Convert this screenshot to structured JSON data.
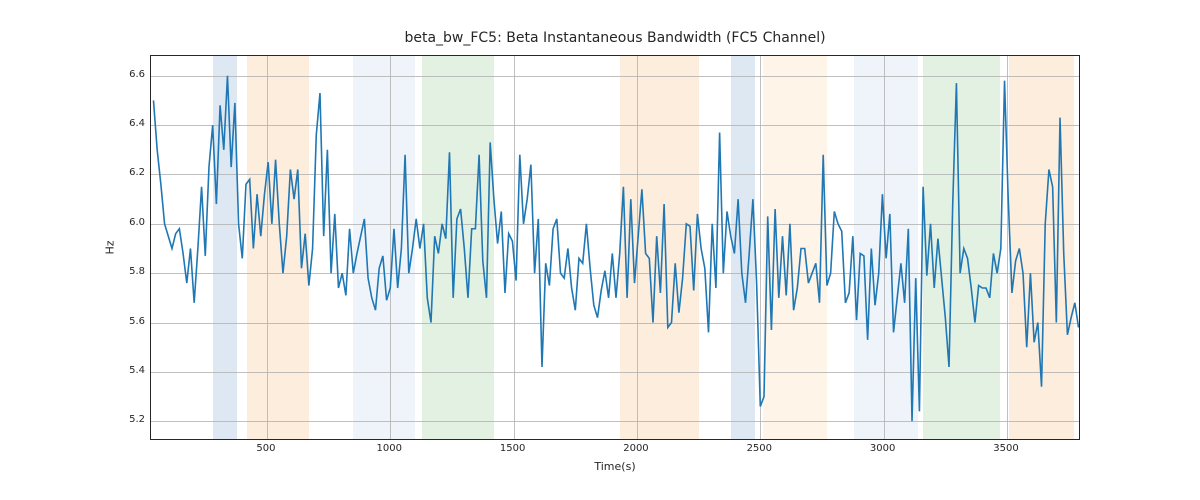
{
  "chart_data": {
    "type": "line",
    "title": "beta_bw_FC5: Beta Instantaneous Bandwidth (FC5 Channel)",
    "xlabel": "Time(s)",
    "ylabel": "Hz",
    "xlim": [
      30,
      3800
    ],
    "ylim": [
      5.12,
      6.68
    ],
    "xticks": [
      500,
      1000,
      1500,
      2000,
      2500,
      3000,
      3500
    ],
    "yticks": [
      5.2,
      5.4,
      5.6,
      5.8,
      6.0,
      6.2,
      6.4,
      6.6
    ],
    "bands": [
      {
        "x0": 280,
        "x1": 380,
        "color": "#b6cde2"
      },
      {
        "x0": 420,
        "x1": 670,
        "color": "#fad8b1"
      },
      {
        "x0": 850,
        "x1": 1100,
        "color": "#dbe7f3"
      },
      {
        "x0": 1130,
        "x1": 1420,
        "color": "#c1dfc0"
      },
      {
        "x0": 1930,
        "x1": 2250,
        "color": "#fad8b1"
      },
      {
        "x0": 2380,
        "x1": 2480,
        "color": "#b6cde2"
      },
      {
        "x0": 2510,
        "x1": 2770,
        "color": "#fce7cd"
      },
      {
        "x0": 2880,
        "x1": 3140,
        "color": "#dbe7f3"
      },
      {
        "x0": 3160,
        "x1": 3470,
        "color": "#c1dfc0"
      },
      {
        "x0": 3510,
        "x1": 3770,
        "color": "#fad8b1"
      }
    ],
    "series": [
      {
        "name": "beta_bw_FC5",
        "color": "#1f77b4",
        "x": [
          40,
          55,
          70,
          85,
          100,
          115,
          130,
          145,
          160,
          175,
          190,
          205,
          220,
          235,
          250,
          265,
          280,
          295,
          310,
          325,
          340,
          355,
          370,
          385,
          400,
          415,
          430,
          445,
          460,
          475,
          490,
          505,
          520,
          535,
          550,
          565,
          580,
          595,
          610,
          625,
          640,
          655,
          670,
          685,
          700,
          715,
          730,
          745,
          760,
          775,
          790,
          805,
          820,
          835,
          850,
          865,
          880,
          895,
          910,
          925,
          940,
          955,
          970,
          985,
          1000,
          1015,
          1030,
          1045,
          1060,
          1075,
          1090,
          1105,
          1120,
          1135,
          1150,
          1165,
          1180,
          1195,
          1210,
          1225,
          1240,
          1255,
          1270,
          1285,
          1300,
          1315,
          1330,
          1345,
          1360,
          1375,
          1390,
          1405,
          1420,
          1435,
          1450,
          1465,
          1480,
          1495,
          1510,
          1525,
          1540,
          1555,
          1570,
          1585,
          1600,
          1615,
          1630,
          1645,
          1660,
          1675,
          1690,
          1705,
          1720,
          1735,
          1750,
          1765,
          1780,
          1795,
          1810,
          1825,
          1840,
          1855,
          1870,
          1885,
          1900,
          1915,
          1930,
          1945,
          1960,
          1975,
          1990,
          2005,
          2020,
          2035,
          2050,
          2065,
          2080,
          2095,
          2110,
          2125,
          2140,
          2155,
          2170,
          2185,
          2200,
          2215,
          2230,
          2245,
          2260,
          2275,
          2290,
          2305,
          2320,
          2335,
          2350,
          2365,
          2380,
          2395,
          2410,
          2425,
          2440,
          2455,
          2470,
          2485,
          2500,
          2515,
          2530,
          2545,
          2560,
          2575,
          2590,
          2605,
          2620,
          2635,
          2650,
          2665,
          2680,
          2695,
          2710,
          2725,
          2740,
          2755,
          2770,
          2785,
          2800,
          2815,
          2830,
          2845,
          2860,
          2875,
          2890,
          2905,
          2920,
          2935,
          2950,
          2965,
          2980,
          2995,
          3010,
          3025,
          3040,
          3055,
          3070,
          3085,
          3100,
          3115,
          3130,
          3145,
          3160,
          3175,
          3190,
          3205,
          3220,
          3235,
          3250,
          3265,
          3280,
          3295,
          3310,
          3325,
          3340,
          3355,
          3370,
          3385,
          3400,
          3415,
          3430,
          3445,
          3460,
          3475,
          3490,
          3505,
          3520,
          3535,
          3550,
          3565,
          3580,
          3595,
          3610,
          3625,
          3640,
          3655,
          3670,
          3685,
          3700,
          3715,
          3730,
          3745,
          3760,
          3775,
          3790
        ],
        "y": [
          6.5,
          6.3,
          6.16,
          6.0,
          5.95,
          5.9,
          5.96,
          5.98,
          5.88,
          5.76,
          5.9,
          5.68,
          5.9,
          6.15,
          5.87,
          6.23,
          6.4,
          6.08,
          6.48,
          6.3,
          6.6,
          6.23,
          6.49,
          6.0,
          5.86,
          6.16,
          6.18,
          5.9,
          6.12,
          5.95,
          6.12,
          6.25,
          6.0,
          6.26,
          6.0,
          5.8,
          5.95,
          6.22,
          6.1,
          6.22,
          5.82,
          5.96,
          5.75,
          5.9,
          6.36,
          6.53,
          5.95,
          6.3,
          5.8,
          6.04,
          5.74,
          5.8,
          5.71,
          5.98,
          5.8,
          5.88,
          5.95,
          6.02,
          5.78,
          5.7,
          5.65,
          5.82,
          5.87,
          5.69,
          5.74,
          5.98,
          5.74,
          5.9,
          6.28,
          5.8,
          5.9,
          6.02,
          5.9,
          6.0,
          5.7,
          5.6,
          5.95,
          5.88,
          6.0,
          5.94,
          6.29,
          5.7,
          6.02,
          6.06,
          5.9,
          5.7,
          5.98,
          5.98,
          6.28,
          5.85,
          5.7,
          6.33,
          6.1,
          5.92,
          6.05,
          5.72,
          5.96,
          5.93,
          5.77,
          6.28,
          6.0,
          6.1,
          6.24,
          5.8,
          6.02,
          5.42,
          5.84,
          5.75,
          5.98,
          6.02,
          5.8,
          5.78,
          5.9,
          5.74,
          5.65,
          5.86,
          5.84,
          6.0,
          5.82,
          5.67,
          5.62,
          5.73,
          5.81,
          5.7,
          5.88,
          5.7,
          5.88,
          6.15,
          5.7,
          6.1,
          5.76,
          5.95,
          6.14,
          5.88,
          5.86,
          5.6,
          5.95,
          5.72,
          6.08,
          5.58,
          5.6,
          5.84,
          5.64,
          5.78,
          6.0,
          5.99,
          5.73,
          6.04,
          5.9,
          5.82,
          5.56,
          6.0,
          5.74,
          6.37,
          5.8,
          6.05,
          5.95,
          5.88,
          6.1,
          5.8,
          5.68,
          5.88,
          6.1,
          5.76,
          5.26,
          5.3,
          6.03,
          5.57,
          6.06,
          5.7,
          5.95,
          5.71,
          6.0,
          5.65,
          5.74,
          5.9,
          5.9,
          5.76,
          5.8,
          5.84,
          5.68,
          6.28,
          5.75,
          5.8,
          6.05,
          6.0,
          5.97,
          5.68,
          5.72,
          5.95,
          5.61,
          5.88,
          5.87,
          5.53,
          5.9,
          5.67,
          5.8,
          6.12,
          5.86,
          6.04,
          5.56,
          5.7,
          5.84,
          5.68,
          5.98,
          5.2,
          5.78,
          5.24,
          6.15,
          5.79,
          6.0,
          5.74,
          5.94,
          5.78,
          5.62,
          5.42,
          6.08,
          6.57,
          5.8,
          5.9,
          5.86,
          5.74,
          5.6,
          5.75,
          5.74,
          5.74,
          5.7,
          5.88,
          5.8,
          5.9,
          6.58,
          6.1,
          5.72,
          5.85,
          5.9,
          5.8,
          5.5,
          5.8,
          5.52,
          5.6,
          5.34,
          6.0,
          6.22,
          6.15,
          5.6,
          6.43,
          5.88,
          5.55,
          5.62,
          5.68,
          5.58
        ]
      }
    ]
  }
}
